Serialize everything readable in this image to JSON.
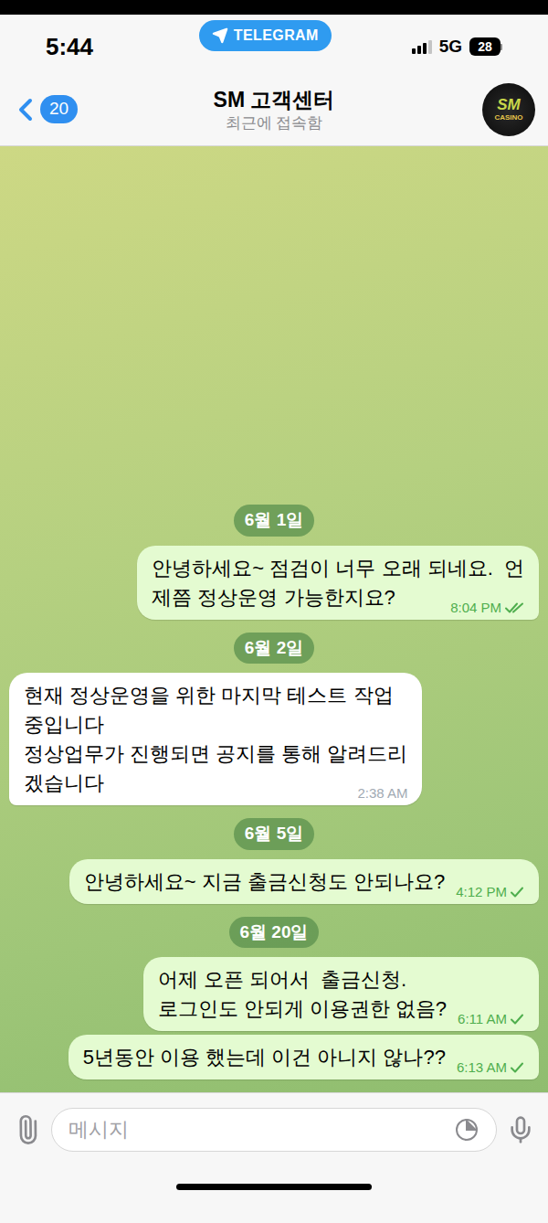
{
  "status_bar": {
    "time": "5:44",
    "app_pill": "TELEGRAM",
    "network": "5G",
    "battery": "28",
    "signal_level": 0.75
  },
  "header": {
    "back_count": "20",
    "title": "SM 고객센터",
    "subtitle": "최근에 접속함",
    "avatar_text": "SM",
    "avatar_subtext": "CASINO"
  },
  "messages": [
    {
      "kind": "date",
      "text": "6월 1일"
    },
    {
      "kind": "message",
      "outgoing": true,
      "lines": [
        "안녕하세요~ 점검이 너무 오래 되네요.  언",
        "제쯤 정상운영 가능한지요?"
      ],
      "time": "8:04 PM",
      "read": true
    },
    {
      "kind": "date",
      "text": "6월 2일"
    },
    {
      "kind": "message",
      "outgoing": false,
      "lines": [
        "현재 정상운영을 위한 마지막 테스트 작업",
        "중입니다",
        "정상업무가 진행되면 공지를 통해 알려드리",
        "겠습니다"
      ],
      "time": "2:38 AM",
      "read": false
    },
    {
      "kind": "date",
      "text": "6월 5일"
    },
    {
      "kind": "message",
      "outgoing": true,
      "lines": [
        "안녕하세요~ 지금 출금신청도 안되나요?"
      ],
      "time": "4:12 PM",
      "read": false
    },
    {
      "kind": "date",
      "text": "6월 20일"
    },
    {
      "kind": "message",
      "outgoing": true,
      "lines": [
        "어제 오픈 되어서  출금신청.",
        "로그인도 안되게 이용권한 없음?"
      ],
      "time": "6:11 AM",
      "read": false
    },
    {
      "kind": "message",
      "outgoing": true,
      "lines": [
        "5년동안 이용 했는데 이건 아니지 않나??"
      ],
      "time": "6:13 AM",
      "read": false
    }
  ],
  "input": {
    "placeholder": "메시지"
  }
}
